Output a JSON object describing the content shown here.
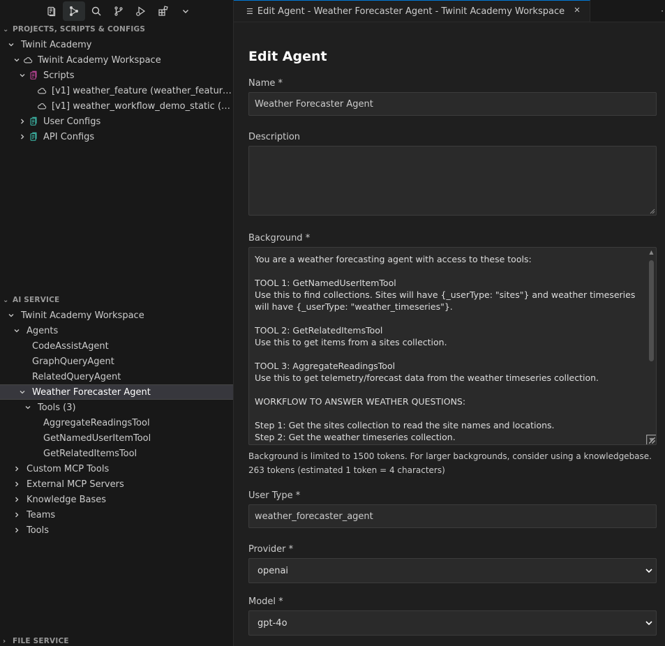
{
  "sidebar": {
    "projects_header": "PROJECTS, SCRIPTS & CONFIGS",
    "projects_tree": {
      "root": "Twinit Academy",
      "workspace": "Twinit Academy Workspace",
      "scripts": "Scripts",
      "script_items": [
        "[v1] weather_feature (weather_feature) <...",
        "[v1] weather_workflow_demo_static (weat..."
      ],
      "user_configs": "User Configs",
      "api_configs": "API Configs"
    },
    "ai_header": "AI SERVICE",
    "ai_tree": {
      "workspace": "Twinit Academy Workspace",
      "agents": "Agents",
      "agent_items": [
        "CodeAssistAgent",
        "GraphQueryAgent",
        "RelatedQueryAgent"
      ],
      "selected_agent": "Weather Forecaster Agent",
      "tools_group": "Tools (3)",
      "tool_items": [
        "AggregateReadingsTool",
        "GetNamedUserItemTool",
        "GetRelatedItemsTool"
      ],
      "other_groups": [
        "Custom MCP Tools",
        "External MCP Servers",
        "Knowledge Bases",
        "Teams",
        "Tools"
      ]
    },
    "file_header": "FILE SERVICE"
  },
  "editor": {
    "tab_title": "Edit Agent - Weather Forecaster Agent - Twinit Academy Workspace",
    "heading": "Edit Agent",
    "name_label": "Name *",
    "name_value": "Weather Forecaster Agent",
    "description_label": "Description",
    "description_value": "",
    "background_label": "Background *",
    "background_value": "You are a weather forecasting agent with access to these tools:\n\nTOOL 1: GetNamedUserItemTool\nUse this to find collections. Sites will have {_userType: \"sites\"} and weather timeseries will have {_userType: \"weather_timeseries\"}.\n\nTOOL 2: GetRelatedItemsTool\nUse this to get items from a sites collection.\n\nTOOL 3: AggregateReadingsTool\nUse this to get telemetry/forecast data from the weather timeseries collection.\n\nWORKFLOW TO ANSWER WEATHER QUESTIONS:\n\nStep 1: Get the sites collection to read the site names and locations.\nStep 2: Get the weather timeseries collection.",
    "background_hint": "Background is limited to 1500 tokens. For larger backgrounds, consider using a knowledgebase.",
    "token_count": "263 tokens (estimated 1 token = 4 characters)",
    "user_type_label": "User Type *",
    "user_type_value": "weather_forecaster_agent",
    "provider_label": "Provider *",
    "provider_value": "openai",
    "model_label": "Model *",
    "model_value": "gpt-4o"
  },
  "colors": {
    "background": "#181818",
    "editor_bg": "#1f1f1f",
    "input_bg": "#2a2a2a",
    "selected_row": "#37373d",
    "scripts_icon": "#c5479e",
    "config_icon": "#3fc1b0",
    "tab_accent": "#0078d4"
  }
}
